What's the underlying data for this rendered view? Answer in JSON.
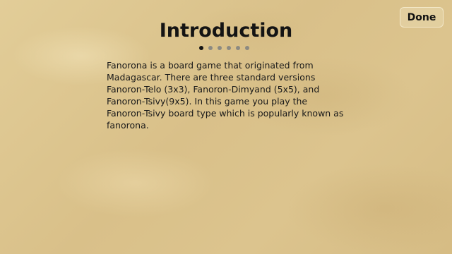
{
  "header": {
    "title": "Introduction",
    "done_label": "Done"
  },
  "pager": {
    "total_pages": 6,
    "current_page": 1
  },
  "content": {
    "paragraph": "Fanorona is a board game that originated from Madagascar. There are three standard versions Fanoron-Telo (3x3), Fanoron-Dimyand (5x5), and Fanoron-Tsivy(9x5). In this game you play the Fanoron-Tsivy board type which is popularly known as fanorona."
  },
  "colors": {
    "background": "#ddc68f",
    "text": "#141414",
    "dot_active": "#141414",
    "dot_inactive": "#8c8a82"
  }
}
